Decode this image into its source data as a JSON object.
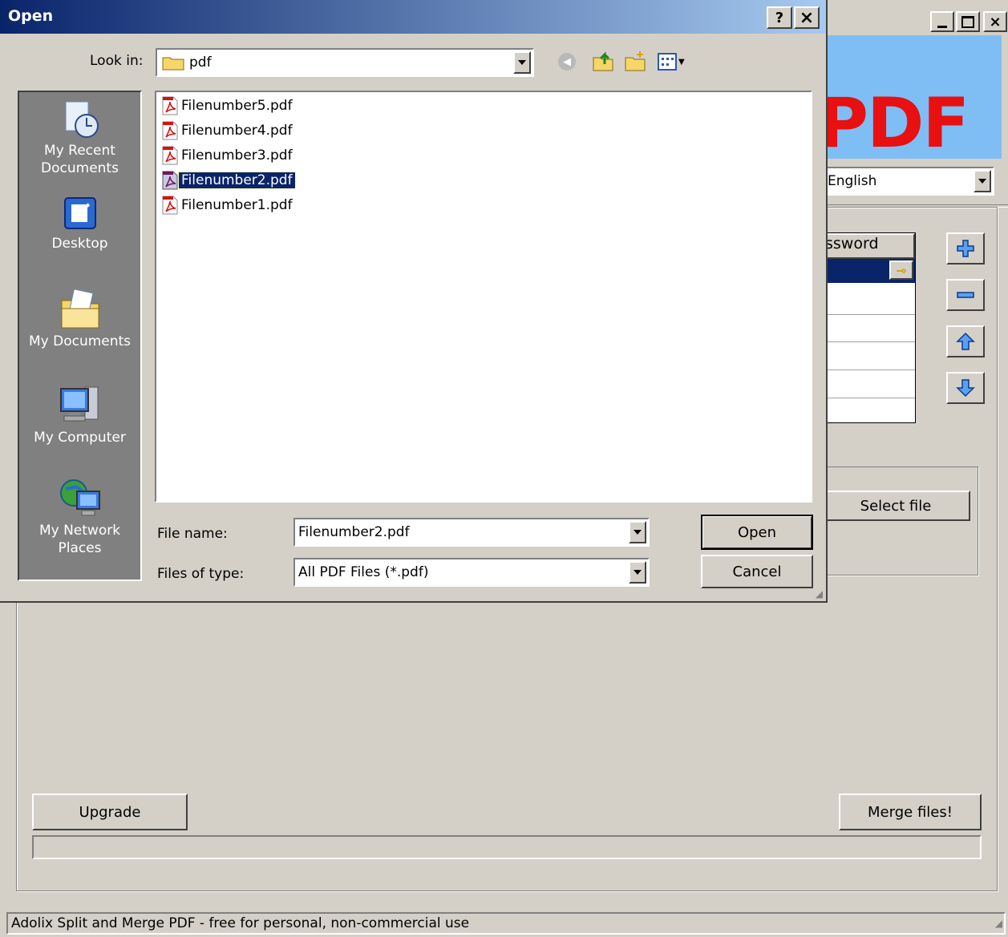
{
  "dialog": {
    "title": "Open",
    "help_label": "?",
    "close_label": "×",
    "look_in_label": "Look in:",
    "look_in_value": "pdf",
    "places": [
      {
        "label_1": "My Recent",
        "label_2": "Documents",
        "icon": "recent-documents-icon"
      },
      {
        "label_1": "Desktop",
        "label_2": "",
        "icon": "desktop-icon"
      },
      {
        "label_1": "My Documents",
        "label_2": "",
        "icon": "my-documents-icon"
      },
      {
        "label_1": "My Computer",
        "label_2": "",
        "icon": "my-computer-icon"
      },
      {
        "label_1": "My Network",
        "label_2": "Places",
        "icon": "network-places-icon"
      }
    ],
    "files": [
      {
        "name": "Filenumber5.pdf",
        "selected": false
      },
      {
        "name": "Filenumber4.pdf",
        "selected": false
      },
      {
        "name": "Filenumber3.pdf",
        "selected": false
      },
      {
        "name": "Filenumber2.pdf",
        "selected": true
      },
      {
        "name": "Filenumber1.pdf",
        "selected": false
      }
    ],
    "file_name_label": "File name:",
    "file_name_value": "Filenumber2.pdf",
    "file_type_label": "Files of type:",
    "file_type_value": "All PDF Files (*.pdf)",
    "open_label": "Open",
    "cancel_label": "Cancel"
  },
  "main": {
    "banner_text": "PDF",
    "language_value": "English",
    "password_header": "ssword",
    "select_file_label": "Select file",
    "upgrade_label": "Upgrade",
    "merge_label": "Merge files!",
    "status_text": "Adolix Split and Merge PDF - free for personal, non-commercial use",
    "accent_color": "#0a246a",
    "banner_color": "#7fbdf5",
    "banner_text_color": "#e81010"
  }
}
